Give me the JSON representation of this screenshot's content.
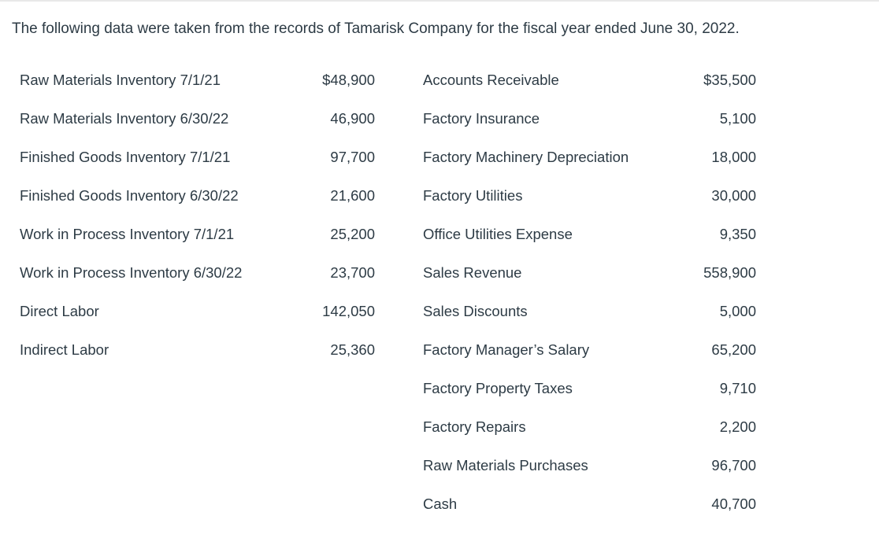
{
  "intro": "The following data were taken from the records of Tamarisk Company for the fiscal year ended June 30, 2022.",
  "rows": [
    {
      "left_label": "Raw Materials Inventory 7/1/21",
      "left_value": "$48,900",
      "right_label": "Accounts Receivable",
      "right_value": "$35,500"
    },
    {
      "left_label": "Raw Materials Inventory 6/30/22",
      "left_value": "46,900",
      "right_label": "Factory Insurance",
      "right_value": "5,100"
    },
    {
      "left_label": "Finished Goods Inventory 7/1/21",
      "left_value": "97,700",
      "right_label": "Factory Machinery Depreciation",
      "right_value": "18,000"
    },
    {
      "left_label": "Finished Goods Inventory 6/30/22",
      "left_value": "21,600",
      "right_label": "Factory Utilities",
      "right_value": "30,000"
    },
    {
      "left_label": "Work in Process Inventory 7/1/21",
      "left_value": "25,200",
      "right_label": "Office Utilities Expense",
      "right_value": "9,350"
    },
    {
      "left_label": "Work in Process Inventory 6/30/22",
      "left_value": "23,700",
      "right_label": "Sales Revenue",
      "right_value": "558,900"
    },
    {
      "left_label": "Direct Labor",
      "left_value": "142,050",
      "right_label": "Sales Discounts",
      "right_value": "5,000"
    },
    {
      "left_label": "Indirect Labor",
      "left_value": "25,360",
      "right_label": "Factory Manager’s Salary",
      "right_value": "65,200"
    },
    {
      "left_label": "",
      "left_value": "",
      "right_label": "Factory Property Taxes",
      "right_value": "9,710"
    },
    {
      "left_label": "",
      "left_value": "",
      "right_label": "Factory Repairs",
      "right_value": "2,200"
    },
    {
      "left_label": "",
      "left_value": "",
      "right_label": "Raw Materials Purchases",
      "right_value": "96,700"
    },
    {
      "left_label": "",
      "left_value": "",
      "right_label": "Cash",
      "right_value": "40,700"
    }
  ]
}
